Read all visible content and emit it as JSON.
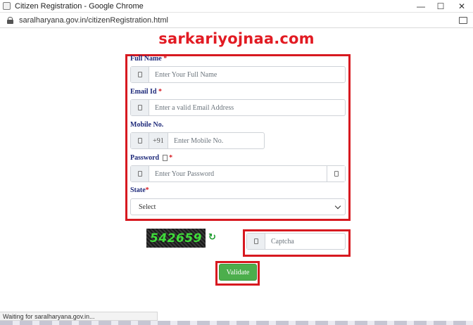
{
  "window": {
    "title": "Citizen Registration - Google Chrome",
    "minimize_glyph": "—",
    "maximize_glyph": "☐",
    "close_glyph": "✕"
  },
  "browser": {
    "url": "saralharyana.gov.in/citizenRegistration.html"
  },
  "watermark": "sarkariyojnaa.com",
  "form": {
    "full_name": {
      "label": "Full Name",
      "required_mark": "*",
      "placeholder": "Enter Your Full Name",
      "icon": "user-icon"
    },
    "email": {
      "label": "Email Id",
      "required_mark": "*",
      "placeholder": "Enter a valid Email Address",
      "icon": "email-icon"
    },
    "mobile": {
      "label": "Mobile No.",
      "prefix": "+91",
      "placeholder": "Enter Mobile No.",
      "icon": "phone-icon"
    },
    "password": {
      "label": "Password",
      "required_mark": "*",
      "placeholder": "Enter Your Password",
      "icon": "lock-icon",
      "toggle_icon": "eye-icon",
      "help_icon": "info-icon"
    },
    "state": {
      "label": "State",
      "required_mark": "*",
      "selected": "Select"
    }
  },
  "captcha": {
    "code": "542659",
    "refresh_glyph": "↻",
    "placeholder": "Captcha",
    "icon": "key-icon"
  },
  "validate_label": "Validate",
  "status_text": "Waiting for saralharyana.gov.in...",
  "colors": {
    "highlight": "#d71920",
    "label": "#1e2a7a",
    "button": "#4cae4c",
    "captcha_text": "#3fdc3a",
    "watermark": "#e21b23"
  }
}
